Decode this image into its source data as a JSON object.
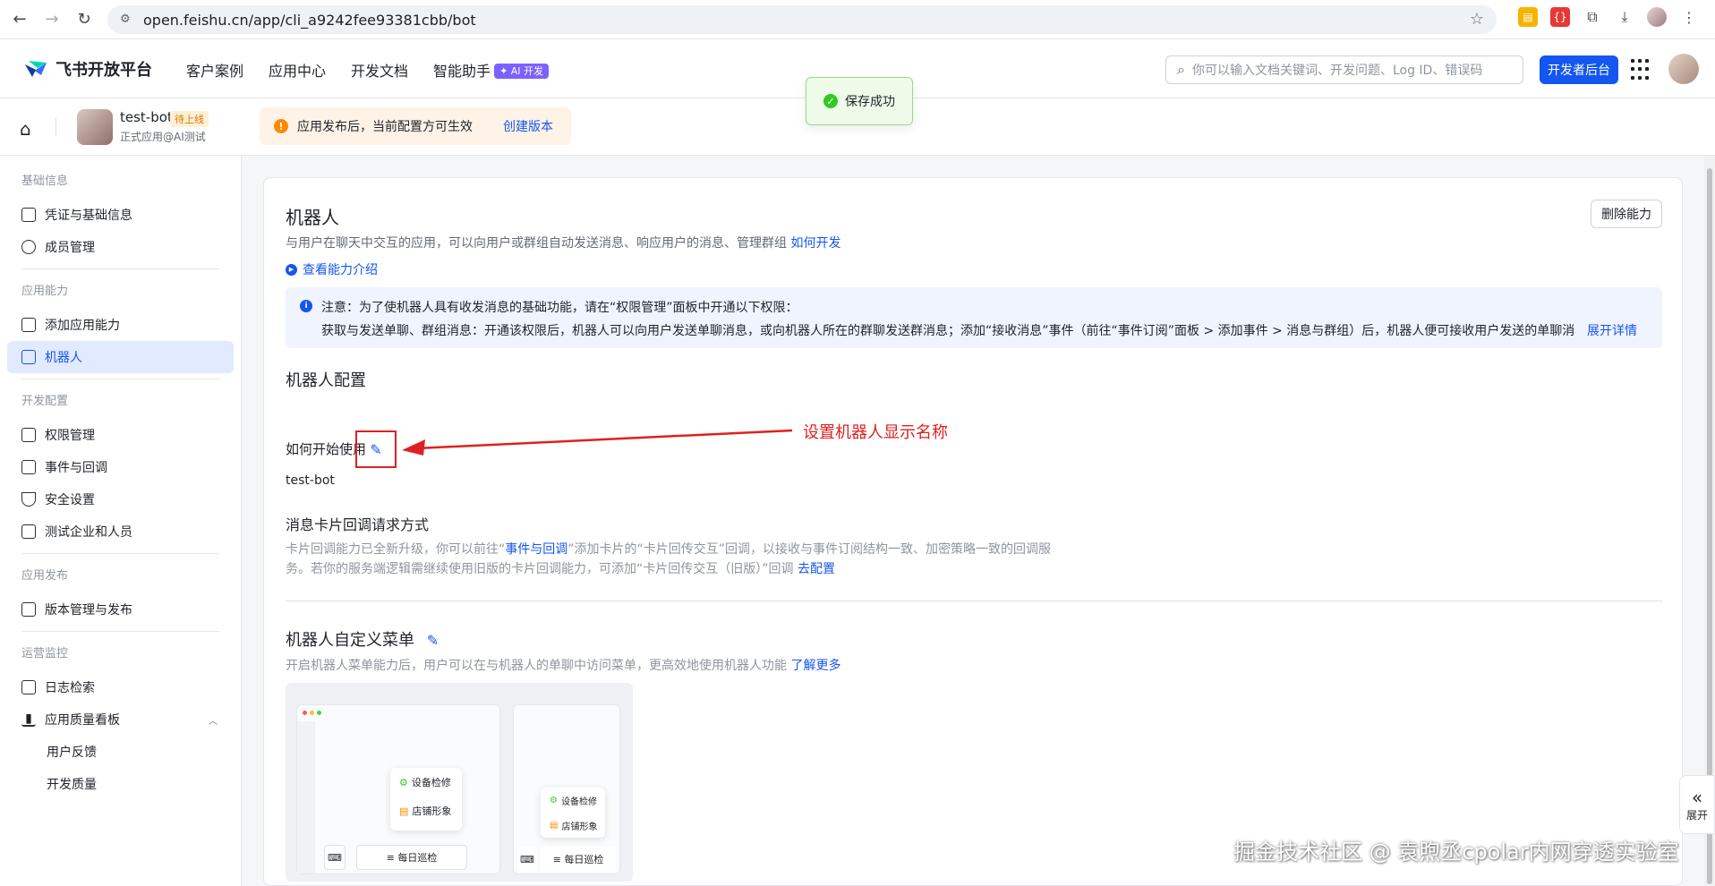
{
  "browser": {
    "url": "open.feishu.cn/app/cli_a9242fee93381cbb/bot"
  },
  "topnav": {
    "logo_text": "飞书开放平台",
    "menu": [
      "客户案例",
      "应用中心",
      "开发文档",
      "智能助手"
    ],
    "ai_badge": "✦ AI 开发",
    "search_placeholder": "你可以输入文档关键词、开发问题、Log ID、错误码",
    "dev_console": "开发者后台"
  },
  "toast": {
    "text": "保存成功"
  },
  "appbar": {
    "app_name": "test-bot",
    "app_badge": "待上线",
    "app_sub": "正式应用@AI测试",
    "notice_text": "应用发布后，当前配置方可生效",
    "notice_link": "创建版本"
  },
  "sidebar": {
    "groups": [
      {
        "title": "基础信息",
        "items": [
          "凭证与基础信息",
          "成员管理"
        ]
      },
      {
        "title": "应用能力",
        "items": [
          "添加应用能力",
          "机器人"
        ]
      },
      {
        "title": "开发配置",
        "items": [
          "权限管理",
          "事件与回调",
          "安全设置",
          "测试企业和人员"
        ]
      },
      {
        "title": "应用发布",
        "items": [
          "版本管理与发布"
        ]
      },
      {
        "title": "运营监控",
        "items": [
          "日志检索",
          "应用质量看板"
        ],
        "subitems": [
          "用户反馈",
          "开发质量"
        ]
      }
    ]
  },
  "main": {
    "title": "机器人",
    "desc": "与用户在聊天中交互的应用，可以向用户或群组自动发送消息、响应用户的消息、管理群组",
    "desc_link": "如何开发",
    "intro_link": "查看能力介绍",
    "delete_button": "删除能力",
    "info_line1": "注意：为了使机器人具有收发消息的基础功能，请在“权限管理”面板中开通以下权限：",
    "info_line2": "获取与发送单聊、群组消息：开通该权限后，机器人可以向用户发送单聊消息，或向机器人所在的群聊发送群消息；添加“接收消息”事件（前往“事件订阅”面板 > 添加事件 > 消息与群组）后，机器人便可接收用户发送的单聊消...",
    "info_more": "展开详情",
    "config_title": "机器人配置",
    "how_to_start": "如何开始使用",
    "bot_name": "test-bot",
    "annotation": "设置机器人显示名称",
    "card_title": "消息卡片回调请求方式",
    "card_desc_1": "卡片回调能力已全新升级，你可以前往“",
    "card_desc_link1": "事件与回调",
    "card_desc_2": "”添加卡片的“卡片回传交互”回调，以接收与事件订阅结构一致、加密策略一致的回调服务。若你的服务端逻辑需继续使用旧版的卡片回调能力，可添加“卡片回传交互（旧版）”回调",
    "card_desc_link2": "去配置",
    "menu_title": "机器人自定义菜单",
    "menu_desc": "开启机器人菜单能力后，用户可以在与机器人的单聊中访问菜单，更高效地使用机器人功能",
    "menu_desc_link": "了解更多",
    "preview": {
      "item1": "设备检修",
      "item2": "店铺形象",
      "bar": "≡ 每日巡检"
    }
  },
  "expand_label": "展开",
  "watermark": "掘金技术社区 @ 袁煦丞cpolar内网穿透实验室"
}
